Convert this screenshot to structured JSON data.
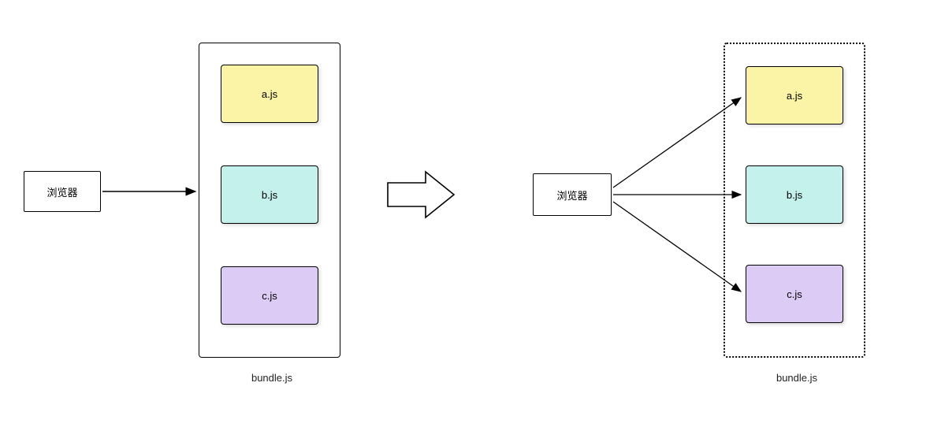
{
  "left": {
    "browser": "浏览器",
    "modules": {
      "a": "a.js",
      "b": "b.js",
      "c": "c.js"
    },
    "bundleLabel": "bundle.js"
  },
  "right": {
    "browser": "浏览器",
    "modules": {
      "a": "a.js",
      "b": "b.js",
      "c": "c.js"
    },
    "bundleLabel": "bundle.js"
  },
  "colors": {
    "a": "#fbf4a7",
    "b": "#c4f1eb",
    "c": "#dccbf4"
  }
}
